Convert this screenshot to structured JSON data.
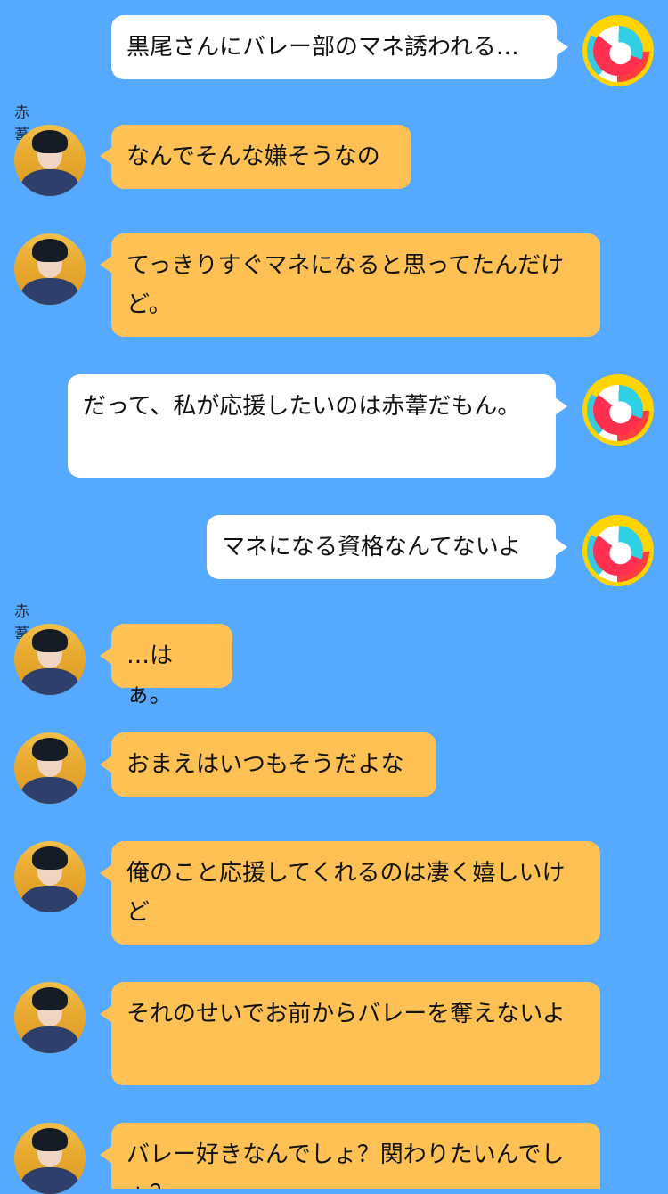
{
  "chat": {
    "background_color": "#55aaff",
    "incoming_bubble_color": "#ffc153",
    "outgoing_bubble_color": "#ffffff",
    "messages": [
      {
        "side": "right",
        "sender": "",
        "text": "黒尾さんにバレー部のマネ誘われる…"
      },
      {
        "side": "left",
        "sender": "赤葦",
        "text": "なんでそんな嫌そうなの"
      },
      {
        "side": "left",
        "sender": "",
        "text": "てっきりすぐマネになると思ってたんだけど。"
      },
      {
        "side": "right",
        "sender": "",
        "text": "だって、私が応援したいのは赤葦だもん。"
      },
      {
        "side": "right",
        "sender": "",
        "text": "マネになる資格なんてないよ"
      },
      {
        "side": "left",
        "sender": "赤葦",
        "text": "…はぁ。"
      },
      {
        "side": "left",
        "sender": "",
        "text": "おまえはいつもそうだよな"
      },
      {
        "side": "left",
        "sender": "",
        "text": "俺のこと応援してくれるのは凄く嬉しいけど"
      },
      {
        "side": "left",
        "sender": "",
        "text": "それのせいでお前からバレーを奪えないよ"
      },
      {
        "side": "left",
        "sender": "",
        "text": "バレー好きなんでしょ？関わりたいんでしょ？"
      }
    ]
  }
}
